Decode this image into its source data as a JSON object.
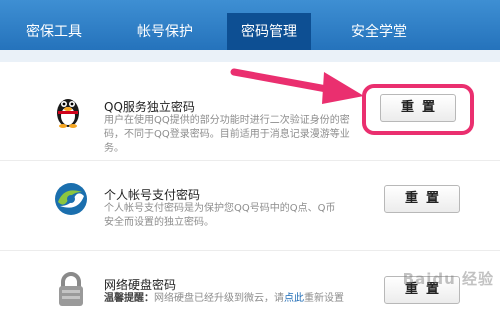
{
  "tabs": [
    {
      "label": "密保工具"
    },
    {
      "label": "帐号保护"
    },
    {
      "label": "密码管理"
    },
    {
      "label": "安全学堂"
    }
  ],
  "active_tab": 2,
  "items": [
    {
      "title": "QQ服务独立密码",
      "desc": "用户在使用QQ提供的部分功能时进行二次验证身份的密码，不同于QQ登录密码。目前适用于消息记录漫游等业务。",
      "button": "重置",
      "icon": "penguin-icon"
    },
    {
      "title": "个人帐号支付密码",
      "desc": "个人帐号支付密码是为保护您QQ号码中的Q点、Q币安全而设置的独立密码。",
      "button": "重置",
      "icon": "swirl-logo-icon"
    },
    {
      "title": "网络硬盘密码",
      "desc_label": "温馨提醒：",
      "desc_text": "网络硬盘已经升级到微云，请",
      "desc_link": "点此",
      "desc_tail": "重新设置",
      "button": "重置",
      "icon": "lock-icon"
    }
  ],
  "watermark": "Baidu 经验",
  "colors": {
    "tab_bg": "#1f6cb6",
    "tab_active": "#0d4f93",
    "highlight": "#ea2f6f"
  }
}
